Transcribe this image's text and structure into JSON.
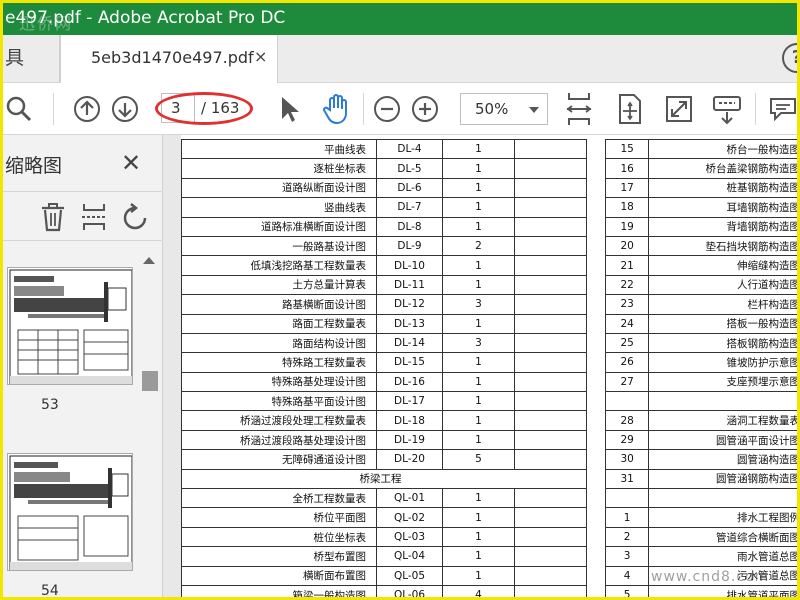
{
  "window": {
    "title": "e497.pdf - Adobe Acrobat Pro DC",
    "watermark_top": "迅侨网",
    "watermark_bottom": "www.cnd8.com"
  },
  "tabs": {
    "left_partial": "具",
    "doc_tab": "5eb3d1470e497.pdf",
    "close_glyph": "×",
    "help_glyph": "?"
  },
  "toolbar": {
    "current_page": "3",
    "total_pages": "/ 163",
    "zoom": "50%",
    "icons": [
      "search-icon",
      "page-up-icon",
      "page-down-icon",
      "select-pointer-icon",
      "hand-tool-icon",
      "zoom-out-icon",
      "zoom-in-icon",
      "zoom-dropdown",
      "fit-page-icon",
      "scroll-mode-icon",
      "fullscreen-icon",
      "read-mode-icon",
      "comment-icon"
    ],
    "hand_tool_color": "#2b7bd9",
    "highlight_color": "#e03030"
  },
  "sidebar": {
    "title": "缩略图",
    "close_glyph": "✕",
    "thumbnails": [
      {
        "label": "53"
      },
      {
        "label": "54"
      }
    ]
  },
  "document": {
    "left_rows": [
      {
        "name": "平曲线表",
        "code": "DL-4",
        "count": "1"
      },
      {
        "name": "逐桩坐标表",
        "code": "DL-5",
        "count": "1"
      },
      {
        "name": "道路纵断面设计图",
        "code": "DL-6",
        "count": "1"
      },
      {
        "name": "竖曲线表",
        "code": "DL-7",
        "count": "1"
      },
      {
        "name": "道路标准横断面设计图",
        "code": "DL-8",
        "count": "1"
      },
      {
        "name": "一般路基设计图",
        "code": "DL-9",
        "count": "2"
      },
      {
        "name": "低填浅挖路基工程数量表",
        "code": "DL-10",
        "count": "1"
      },
      {
        "name": "土方总量计算表",
        "code": "DL-11",
        "count": "1"
      },
      {
        "name": "路基横断面设计图",
        "code": "DL-12",
        "count": "3"
      },
      {
        "name": "路面工程数量表",
        "code": "DL-13",
        "count": "1"
      },
      {
        "name": "路面结构设计图",
        "code": "DL-14",
        "count": "3"
      },
      {
        "name": "特殊路工程数量表",
        "code": "DL-15",
        "count": "1"
      },
      {
        "name": "特殊路基处理设计图",
        "code": "DL-16",
        "count": "1"
      },
      {
        "name": "特殊路基平面设计图",
        "code": "DL-17",
        "count": "1"
      },
      {
        "name": "桥涵过渡段处理工程数量表",
        "code": "DL-18",
        "count": "1"
      },
      {
        "name": "桥涵过渡段路基处理设计图",
        "code": "DL-19",
        "count": "1"
      },
      {
        "name": "无障碍通道设计图",
        "code": "DL-20",
        "count": "5"
      },
      {
        "section": "桥梁工程"
      },
      {
        "name": "全桥工程数量表",
        "code": "QL-01",
        "count": "1"
      },
      {
        "name": "桥位平面图",
        "code": "QL-02",
        "count": "1"
      },
      {
        "name": "桩位坐标表",
        "code": "QL-03",
        "count": "1"
      },
      {
        "name": "桥型布置图",
        "code": "QL-04",
        "count": "1"
      },
      {
        "name": "横断面布置图",
        "code": "QL-05",
        "count": "1"
      },
      {
        "name": "箱梁一般构造图",
        "code": "QL-06",
        "count": "4"
      }
    ],
    "right_rows": [
      {
        "no": "15",
        "name": "桥台一般构造图"
      },
      {
        "no": "16",
        "name": "桥台盖梁钢筋构造图"
      },
      {
        "no": "17",
        "name": "桩基钢筋构造图"
      },
      {
        "no": "18",
        "name": "耳墙钢筋构造图"
      },
      {
        "no": "19",
        "name": "背墙钢筋构造图"
      },
      {
        "no": "20",
        "name": "垫石挡块钢筋构造图"
      },
      {
        "no": "21",
        "name": "伸缩缝构造图"
      },
      {
        "no": "22",
        "name": "人行道构造图"
      },
      {
        "no": "23",
        "name": "栏杆构造图"
      },
      {
        "no": "24",
        "name": "搭板一般构造图"
      },
      {
        "no": "25",
        "name": "搭板钢筋构造图"
      },
      {
        "no": "26",
        "name": "锥坡防护示意图"
      },
      {
        "no": "27",
        "name": "支座预埋示意图"
      },
      {
        "no": "",
        "name": ""
      },
      {
        "no": "28",
        "name": "涵洞工程数量表"
      },
      {
        "no": "29",
        "name": "圆管涵平面设计图"
      },
      {
        "no": "30",
        "name": "圆管涵构造图"
      },
      {
        "no": "31",
        "name": "圆管涵钢筋构造图"
      },
      {
        "no": "",
        "name": ""
      },
      {
        "no": "1",
        "name": "排水工程图例"
      },
      {
        "no": "2",
        "name": "管道综合横断面图"
      },
      {
        "no": "3",
        "name": "雨水管道总图"
      },
      {
        "no": "4",
        "name": "污水管道总图"
      },
      {
        "no": "5",
        "name": "排水管道平面图"
      }
    ]
  }
}
